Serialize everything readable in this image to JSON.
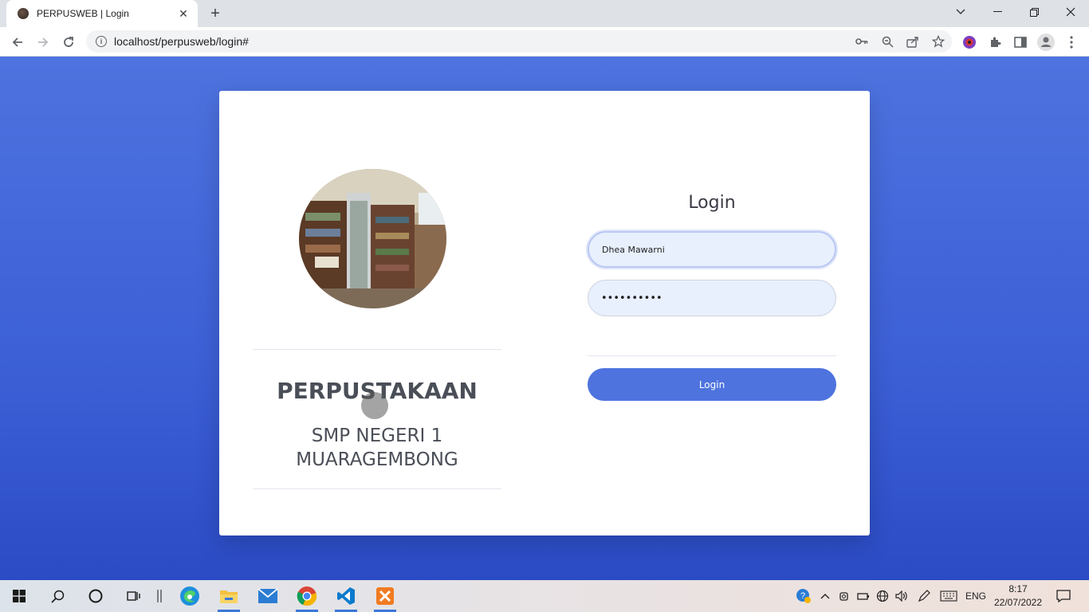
{
  "browser": {
    "tab_title": "PERPUSWEB | Login",
    "url": "localhost/perpusweb/login#"
  },
  "brand": {
    "title": "PERPUSTAKAAN",
    "subtitle_line1": "SMP NEGERI 1",
    "subtitle_line2": "MUARAGEMBONG"
  },
  "login": {
    "title": "Login",
    "username_value": "Dhea Mawarni",
    "password_value": "••••••••••",
    "button_label": "Login"
  },
  "taskbar": {
    "language": "ENG",
    "time": "8:17",
    "date": "22/07/2022"
  },
  "colors": {
    "accent": "#4e73df",
    "background_top": "#4e73df",
    "background_bottom": "#2b4bc5"
  }
}
